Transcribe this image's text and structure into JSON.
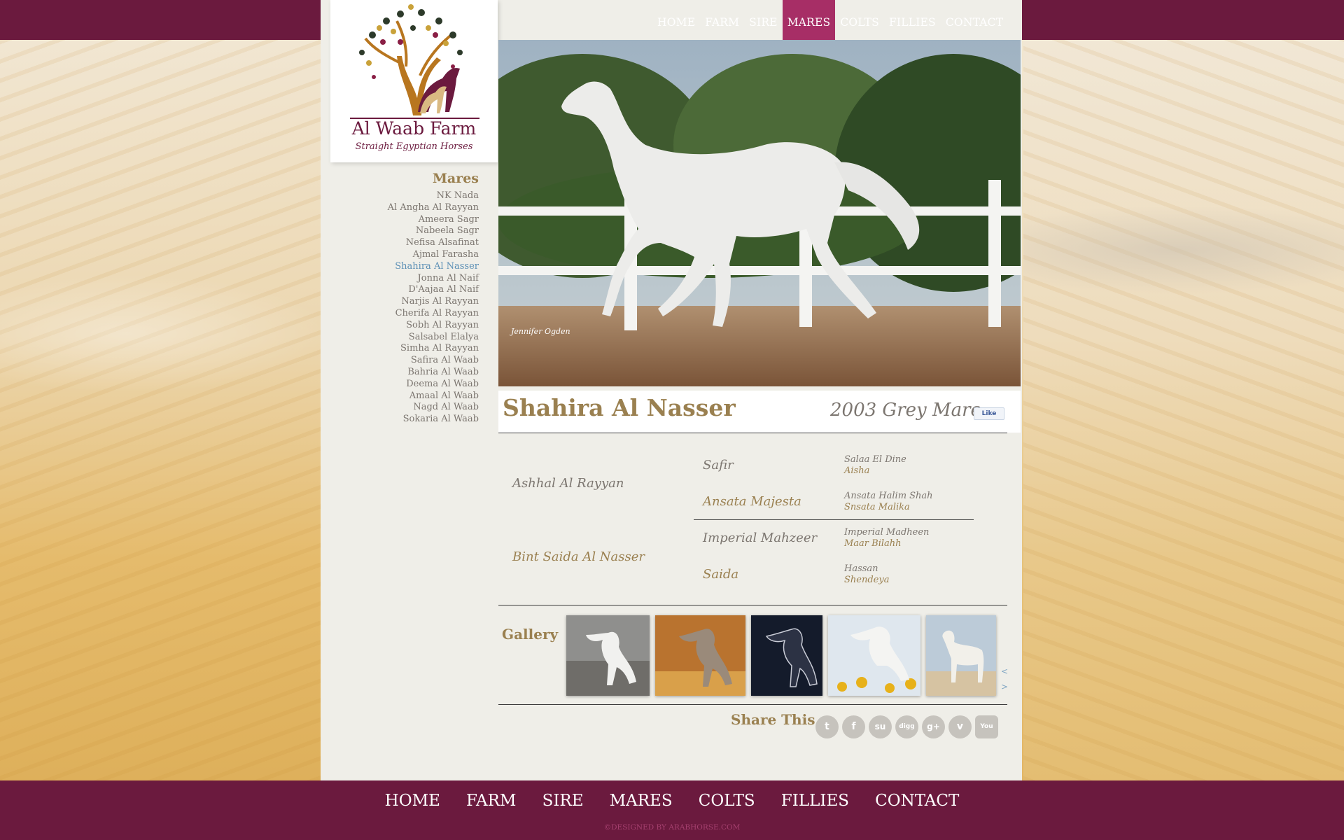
{
  "brand": {
    "name": "Al Waab Farm",
    "tagline": "Straight Egyptian Horses"
  },
  "nav": {
    "items": [
      "HOME",
      "FARM",
      "SIRE",
      "MARES",
      "COLTS",
      "FILLIES",
      "CONTACT"
    ],
    "active": "MARES"
  },
  "sidebar": {
    "heading": "Mares",
    "items": [
      "NK Nada",
      "Al Angha Al Rayyan",
      "Ameera Sagr",
      "Nabeela Sagr",
      "Nefisa Alsafinat",
      "Ajmal Farasha",
      "Shahira Al Nasser",
      "Jonna Al Naif",
      "D'Aajaa Al Naif",
      "Narjis Al Rayyan",
      "Cherifa Al Rayyan",
      "Sobh Al Rayyan",
      "Salsabel Elalya",
      "Simha Al Rayyan",
      "Safira Al Waab",
      "Bahria Al Waab",
      "Deema Al Waab",
      "Amaal Al Waab",
      "Nagd Al Waab",
      "Sokaria Al Waab"
    ],
    "active": "Shahira Al Nasser"
  },
  "horse": {
    "name": "Shahira Al Nasser",
    "description": "2003 Grey Mare",
    "like_label": "Like",
    "photo_credit": "Jennifer Ogden"
  },
  "pedigree": {
    "sire": "Ashhal Al Rayyan",
    "dam": "Bint Saida Al Nasser",
    "sire_sire": "Safir",
    "sire_dam": "Ansata Majesta",
    "dam_sire": "Imperial Mahzeer",
    "dam_dam": "Saida",
    "g3": {
      "safir_sire": "Salaa El Dine",
      "safir_dam": "Aisha",
      "majesta_sire": "Ansata Halim Shah",
      "majesta_dam": "Snsata Malika",
      "mahzeer_sire": "Imperial Madheen",
      "mahzeer_dam": "Maar Bilahh",
      "saida_sire": "Hassan",
      "saida_dam": "Shendeya"
    }
  },
  "gallery": {
    "label": "Gallery",
    "prev": "<",
    "next": ">"
  },
  "share": {
    "label": "Share This",
    "icons": [
      "twitter-icon",
      "facebook-icon",
      "stumbleupon-icon",
      "digg-icon",
      "google-plus-icon",
      "vimeo-icon",
      "youtube-icon"
    ],
    "glyphs": [
      "t",
      "f",
      "su",
      "digg",
      "g+",
      "v",
      "You"
    ]
  },
  "footer": {
    "credit": "©DESIGNED BY ARABHORSE.COM"
  },
  "colors": {
    "brand": "#6b1a3e",
    "accent": "#a72e66",
    "gold": "#9a8050",
    "link_active": "#5b8fb5"
  }
}
